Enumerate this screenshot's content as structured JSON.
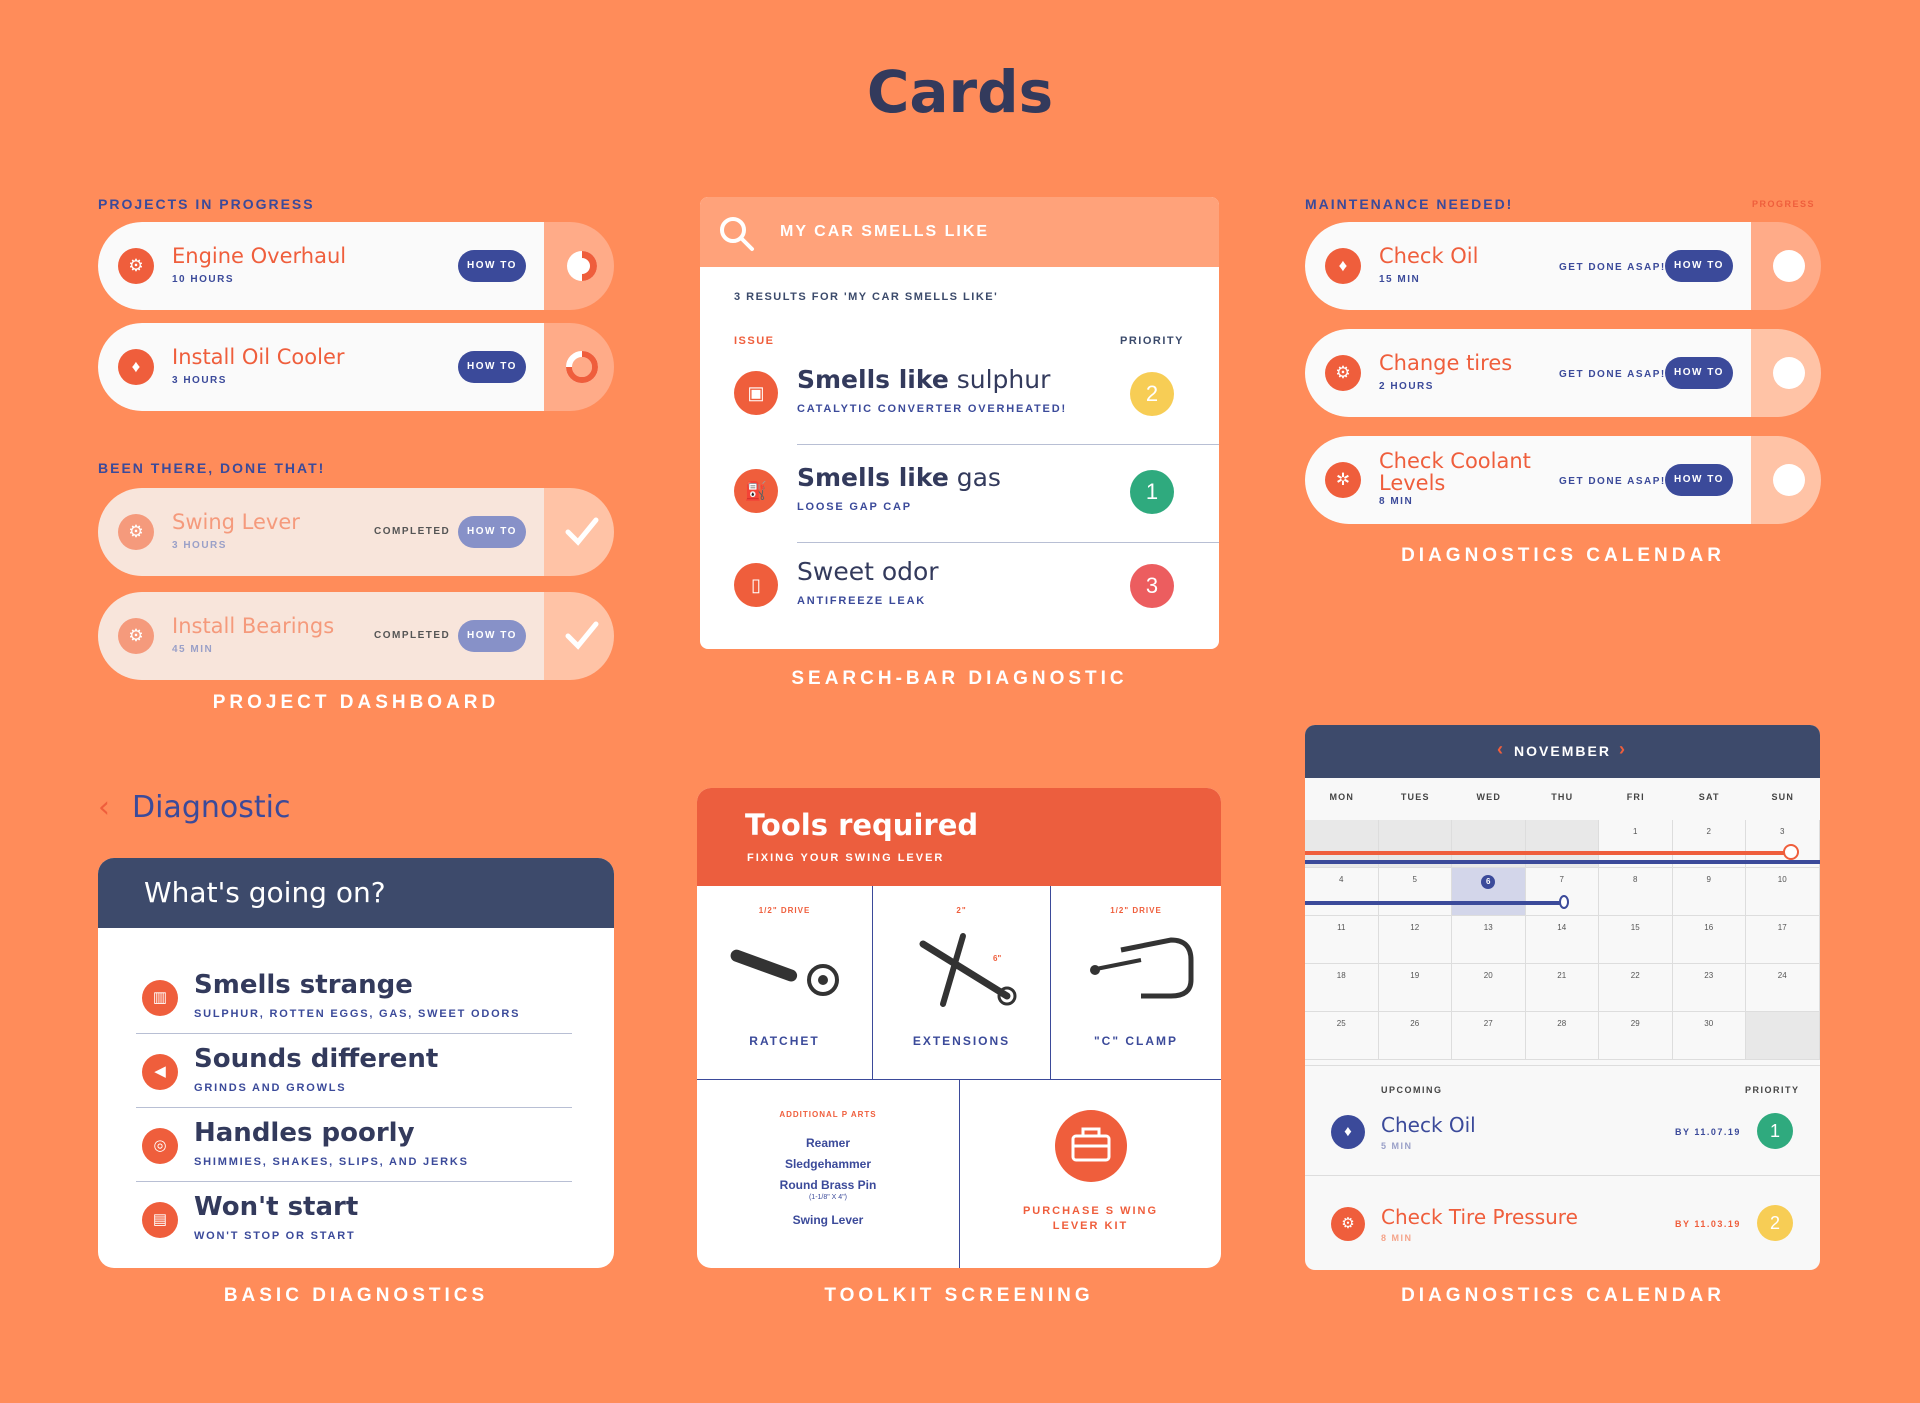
{
  "page_title": "Cards",
  "project_dashboard": {
    "in_progress_label": "PROJECTS IN PROGRESS",
    "done_label": "BEEN THERE, DONE THAT!",
    "caption": "PROJECT DASHBOARD",
    "in_progress": [
      {
        "title": "Engine Overhaul",
        "duration": "10 HOURS",
        "button": "HOW TO",
        "progress": 0.5
      },
      {
        "title": "Install Oil Cooler",
        "duration": "3 HOURS",
        "button": "HOW TO",
        "progress": 0.25
      }
    ],
    "done": [
      {
        "title": "Swing Lever",
        "duration": "3 HOURS",
        "status": "COMPLETED",
        "button": "HOW TO"
      },
      {
        "title": "Install Bearings",
        "duration": "45 MIN",
        "status": "COMPLETED",
        "button": "HOW TO"
      }
    ]
  },
  "search_diagnostic": {
    "query": "MY CAR SMELLS LIKE",
    "results_text": "3 RESULTS FOR 'MY CAR SMELLS LIKE'",
    "col_issue": "ISSUE",
    "col_priority": "PRIORITY",
    "caption": "SEARCH-BAR DIAGNOSTIC",
    "results": [
      {
        "bold": "Smells like",
        "rest": " sulphur",
        "detail": "CATALYTIC CONVERTER OVERHEATED!",
        "priority": "2",
        "color": "#f7cd55"
      },
      {
        "bold": "Smells like",
        "rest": " gas",
        "detail": "LOOSE GAP CAP",
        "priority": "1",
        "color": "#2faa7e"
      },
      {
        "bold": "",
        "rest": "Sweet odor",
        "detail": "ANTIFREEZE LEAK",
        "priority": "3",
        "color": "#ec5d5f"
      }
    ]
  },
  "maintenance": {
    "label": "MAINTENANCE NEEDED!",
    "progress_label": "PROGRESS",
    "caption": "DIAGNOSTICS CALENDAR",
    "items": [
      {
        "title": "Check Oil",
        "duration": "15 MIN",
        "note": "GET DONE ASAP!",
        "button": "HOW TO"
      },
      {
        "title": "Change tires",
        "duration": "2 HOURS",
        "note": "GET DONE ASAP!",
        "button": "HOW TO"
      },
      {
        "title": "Check Coolant Levels",
        "duration": "8 MIN",
        "note": "GET DONE ASAP!",
        "button": "HOW TO"
      }
    ]
  },
  "basic_diagnostics": {
    "back_label": "Diagnostic",
    "header": "What's going on?",
    "caption": "BASIC DIAGNOSTICS",
    "items": [
      {
        "title": "Smells strange",
        "detail": "SULPHUR, ROTTEN EGGS, GAS, SWEET ODORS"
      },
      {
        "title": "Sounds different",
        "detail": "GRINDS AND GROWLS"
      },
      {
        "title": "Handles poorly",
        "detail": "SHIMMIES, SHAKES, SLIPS, AND JERKS"
      },
      {
        "title": "Won't start",
        "detail": "WON'T STOP OR START"
      }
    ]
  },
  "toolkit": {
    "title": "Tools required",
    "subtitle": "FIXING YOUR SWING LEVER",
    "caption": "TOOLKIT SCREENING",
    "tools": [
      {
        "name": "RATCHET",
        "drive": "1/2\" DRIVE"
      },
      {
        "name": "EXTENSIONS",
        "drive": "2\""
      },
      {
        "name": "\"C\" CLAMP",
        "drive": "1/2\" DRIVE"
      }
    ],
    "ext_note": "6\"",
    "parts_header": "ADDITIONAL P    ARTS",
    "parts": [
      "Reamer",
      "Sledgehammer",
      "Round Brass Pin"
    ],
    "pin_size": "(1-1/8\" X 4\")",
    "part_last": "Swing Lever",
    "purchase": "PURCHASE S   WING LEVER KIT"
  },
  "calendar": {
    "month": "NOVEMBER",
    "caption": "DIAGNOSTICS CALENDAR",
    "days_of_week": [
      "MON",
      "TUES",
      "WED",
      "THU",
      "FRI",
      "SAT",
      "SUN"
    ],
    "weeks": [
      [
        "",
        "",
        "",
        "",
        "1",
        "2",
        "3"
      ],
      [
        "4",
        "5",
        "6",
        "7",
        "8",
        "9",
        "10"
      ],
      [
        "11",
        "12",
        "13",
        "14",
        "15",
        "16",
        "17"
      ],
      [
        "18",
        "19",
        "20",
        "21",
        "22",
        "23",
        "24"
      ],
      [
        "25",
        "26",
        "27",
        "28",
        "29",
        "30",
        ""
      ]
    ],
    "today": "6",
    "upcoming_label": "UPCOMING",
    "priority_label": "PRIORITY",
    "upcoming": [
      {
        "title": "Check Oil",
        "duration": "5 MIN",
        "by": "BY 11.07.19",
        "priority": "1",
        "color": "#2faa7e"
      },
      {
        "title": "Check Tire Pressure",
        "duration": "8 MIN",
        "by": "BY 11.03.19",
        "priority": "2",
        "color": "#f7cd55"
      }
    ]
  },
  "colors": {
    "background": "#ff8c5a",
    "accent": "#ef5e3c",
    "navy": "#3b4a9a",
    "dark": "#3d4a6b"
  }
}
